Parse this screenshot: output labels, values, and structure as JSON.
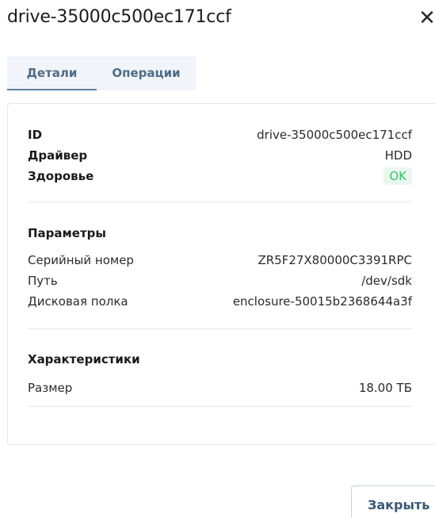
{
  "dialog": {
    "title": "drive-35000c500ec171ccf",
    "close_glyph": "✕"
  },
  "tabs": [
    {
      "label": "Детали",
      "active": true
    },
    {
      "label": "Операции",
      "active": false
    }
  ],
  "general": {
    "id_label": "ID",
    "id_value": "drive-35000c500ec171ccf",
    "driver_label": "Драйвер",
    "driver_value": "HDD",
    "health_label": "Здоровье",
    "health_value": "OK"
  },
  "params": {
    "title": "Параметры",
    "serial_label": "Серийный номер",
    "serial_value": "ZR5F27X80000C3391RPC",
    "path_label": "Путь",
    "path_value": "/dev/sdk",
    "shelf_label": "Дисковая полка",
    "shelf_value": "enclosure-50015b2368644a3f"
  },
  "specs": {
    "title": "Характеристики",
    "size_label": "Размер",
    "size_value": "18.00 ТБ"
  },
  "footer": {
    "close_label": "Закрыть"
  },
  "colors": {
    "accent": "#5f7f9e",
    "ok_text": "#3cbf68",
    "ok_bg": "#e9f7ee"
  },
  "icons": {
    "close": "close-icon"
  }
}
